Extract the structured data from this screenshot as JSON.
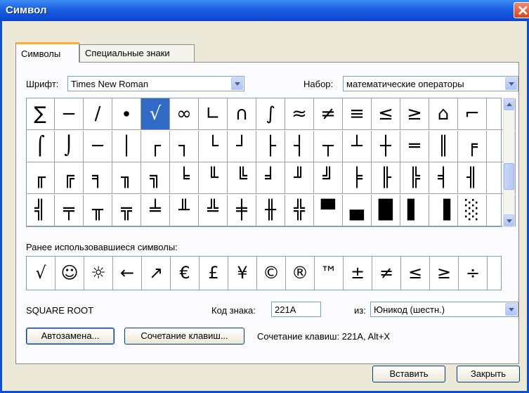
{
  "window": {
    "title": "Символ",
    "close_glyph": "✕"
  },
  "tabs": [
    {
      "label": "Символы",
      "active": true
    },
    {
      "label": "Специальные знаки",
      "active": false
    }
  ],
  "font": {
    "label": "Шрифт:",
    "value": "Times New Roman"
  },
  "subset": {
    "label": "Набор:",
    "value": "математические операторы"
  },
  "symbols": {
    "rows": [
      [
        "∑",
        "−",
        "∕",
        "∙",
        "√",
        "∞",
        "∟",
        "∩",
        "∫",
        "≈",
        "≠",
        "≡",
        "≤",
        "≥",
        "⌂",
        "⌐",
        ""
      ],
      [
        "⌠",
        "⌡",
        "─",
        "│",
        "┌",
        "┐",
        "└",
        "┘",
        "├",
        "┤",
        "┬",
        "┴",
        "┼",
        "═",
        "║",
        "╒",
        ""
      ],
      [
        "╓",
        "╔",
        "╕",
        "╖",
        "╗",
        "╘",
        "╙",
        "╚",
        "╛",
        "╜",
        "╝",
        "╞",
        "╟",
        "╠",
        "╡",
        "╢",
        ""
      ],
      [
        "╣",
        "╤",
        "╥",
        "╦",
        "╧",
        "╨",
        "╩",
        "╪",
        "╫",
        "╬",
        "▀",
        "▄",
        "█",
        "▌",
        "▐",
        "░",
        ""
      ]
    ],
    "selected": "√"
  },
  "recent": {
    "label": "Ранее использовавшиеся символы:",
    "items": [
      "√",
      "☺",
      "☼",
      "←",
      "↗",
      "€",
      "£",
      "¥",
      "©",
      "®",
      "™",
      "±",
      "≠",
      "≤",
      "≥",
      "÷"
    ]
  },
  "char_name": "SQUARE ROOT",
  "char_code": {
    "label": "Код знака:",
    "value": "221A"
  },
  "from": {
    "label": "из:",
    "value": "Юникод (шестн.)"
  },
  "buttons": {
    "autocorrect": "Автозамена...",
    "shortcut_key": "Сочетание клавиш...",
    "insert": "Вставить",
    "close": "Закрыть"
  },
  "shortcut_text": "Сочетание клавиш: 221A, Alt+X"
}
